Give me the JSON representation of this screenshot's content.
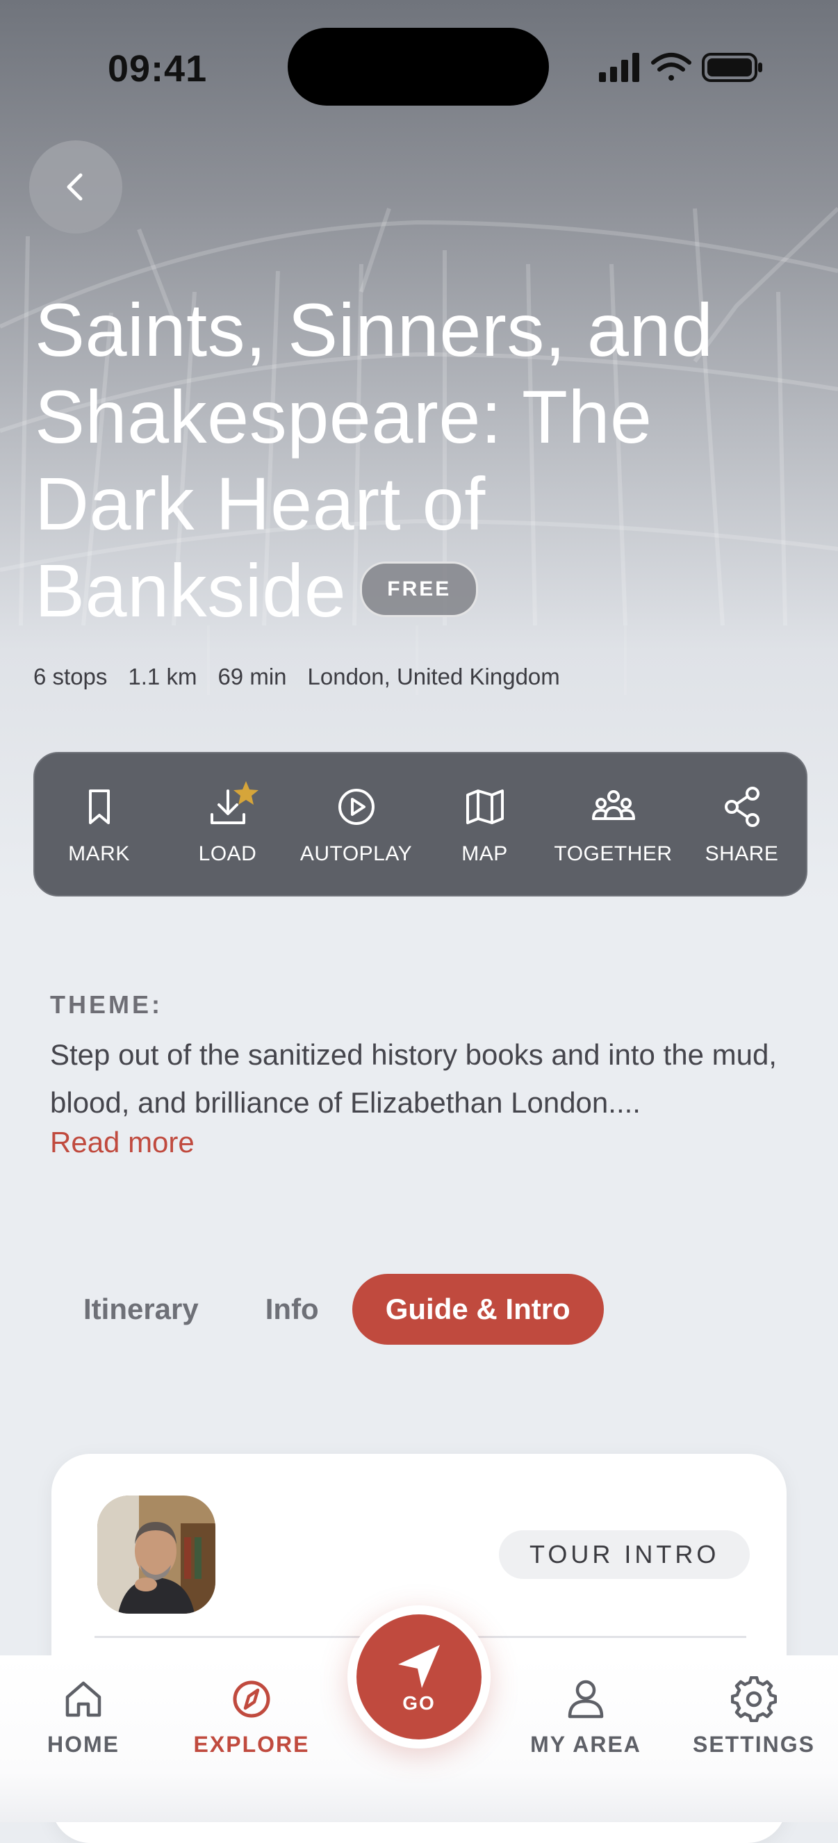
{
  "colors": {
    "accent": "#c04a3e",
    "action_bar": "#5d6067",
    "background": "#eaedf1",
    "star": "#d6a53a"
  },
  "status_bar": {
    "time": "09:41"
  },
  "tour": {
    "title": "Saints, Sinners, and Shakespeare: The Dark Heart of Bankside",
    "price_badge": "FREE",
    "meta": {
      "stops": "6 stops",
      "distance": "1.1 km",
      "duration": "69 min",
      "location": "London, United Kingdom"
    }
  },
  "actions": [
    {
      "label": "MARK",
      "icon": "bookmark-icon"
    },
    {
      "label": "LOAD",
      "icon": "download-icon"
    },
    {
      "label": "AUTOPLAY",
      "icon": "play-circle-icon"
    },
    {
      "label": "MAP",
      "icon": "map-icon"
    },
    {
      "label": "TOGETHER",
      "icon": "group-icon"
    },
    {
      "label": "SHARE",
      "icon": "share-icon"
    }
  ],
  "theme": {
    "heading": "THEME:",
    "body": "Step out of the sanitized history books and into the mud, blood, and brilliance of Elizabethan London....",
    "read_more": "Read more"
  },
  "tabs": [
    {
      "label": "Itinerary",
      "active": false
    },
    {
      "label": "Info",
      "active": false
    },
    {
      "label": "Guide & Intro",
      "active": true
    }
  ],
  "guide_card": {
    "badge": "TOUR INTRO",
    "avatar": "guide-portrait"
  },
  "bottom_nav": {
    "home": "HOME",
    "explore": "EXPLORE",
    "go": "GO",
    "my_area": "MY AREA",
    "settings": "SETTINGS",
    "active": "EXPLORE"
  }
}
